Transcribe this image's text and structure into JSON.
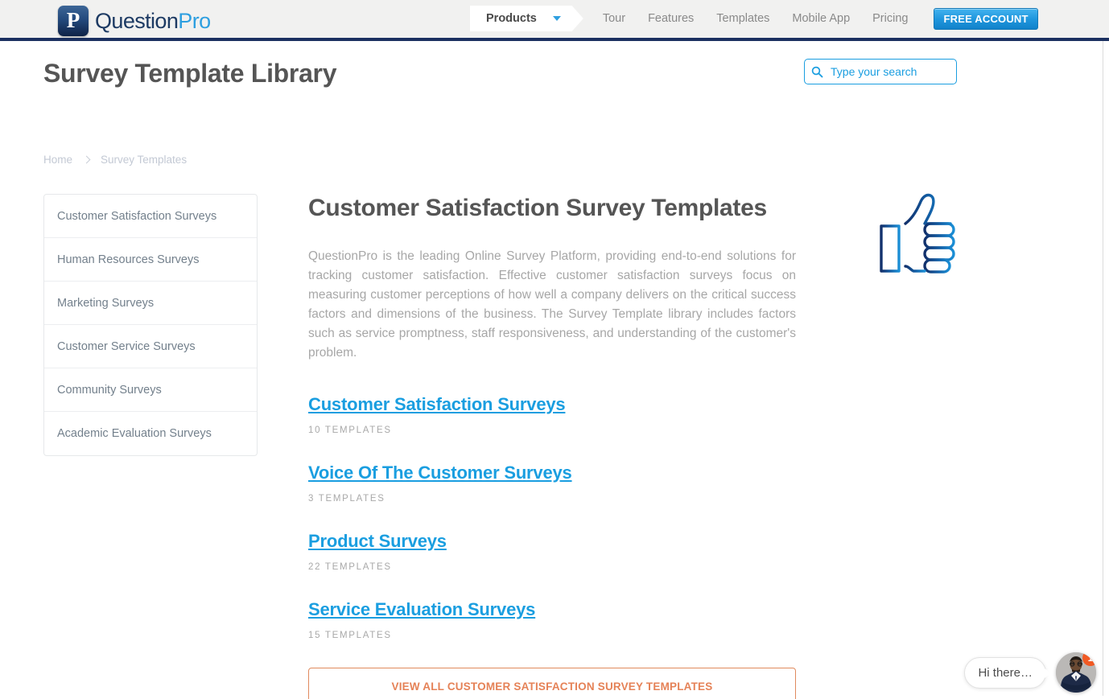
{
  "header": {
    "logo": {
      "mark_glyph": "P",
      "name_part1": "Question",
      "name_part2": "Pro",
      "icon_name": "questionpro-logo-icon"
    },
    "nav": {
      "products_label": "Products",
      "dropdown_icon": "chevron-down-icon",
      "links": [
        {
          "label": "Tour"
        },
        {
          "label": "Features"
        },
        {
          "label": "Templates"
        },
        {
          "label": "Mobile App"
        },
        {
          "label": "Pricing"
        }
      ],
      "cta_label": "FREE ACCOUNT"
    }
  },
  "page": {
    "title": "Survey Template Library",
    "search": {
      "placeholder": "Type your search",
      "value": "",
      "icon_name": "search-icon"
    },
    "breadcrumb": {
      "home": "Home",
      "separator_icon": "chevron-right-icon",
      "current": "Survey Templates"
    }
  },
  "sidebar": {
    "items": [
      {
        "label": "Customer Satisfaction Surveys"
      },
      {
        "label": "Human Resources Surveys"
      },
      {
        "label": "Marketing Surveys"
      },
      {
        "label": "Customer Service Surveys"
      },
      {
        "label": "Community Surveys"
      },
      {
        "label": "Academic Evaluation Surveys"
      }
    ]
  },
  "main": {
    "heading": "Customer Satisfaction Survey Templates",
    "intro": "QuestionPro is the leading Online Survey Platform, providing end-to-end solutions for tracking customer satisfaction. Effective customer satisfaction surveys focus on measuring customer perceptions of how well a company delivers on the critical success factors and dimensions of the business. The Survey Template library includes factors such as service promptness, staff responsiveness, and understanding of the customer's problem.",
    "categories": [
      {
        "label": "Customer Satisfaction Surveys",
        "count": "10 TEMPLATES"
      },
      {
        "label": "Voice Of The Customer Surveys",
        "count": "3 TEMPLATES"
      },
      {
        "label": "Product Surveys",
        "count": "22 TEMPLATES"
      },
      {
        "label": "Service Evaluation Surveys",
        "count": "15 TEMPLATES"
      }
    ],
    "cta_label": "VIEW ALL CUSTOMER SATISFACTION SURVEY TEMPLATES",
    "hero_icon": "thumbs-up-icon"
  },
  "chat": {
    "message": "Hi there…",
    "badge_count": "1",
    "avatar_icon": "agent-avatar"
  },
  "colors": {
    "brand_blue": "#1a9ee0",
    "navy": "#1b3060",
    "cta_orange": "#e58257",
    "badge_orange": "#f15a24",
    "text_gray": "#555555",
    "muted_gray": "#a7a7a7"
  }
}
